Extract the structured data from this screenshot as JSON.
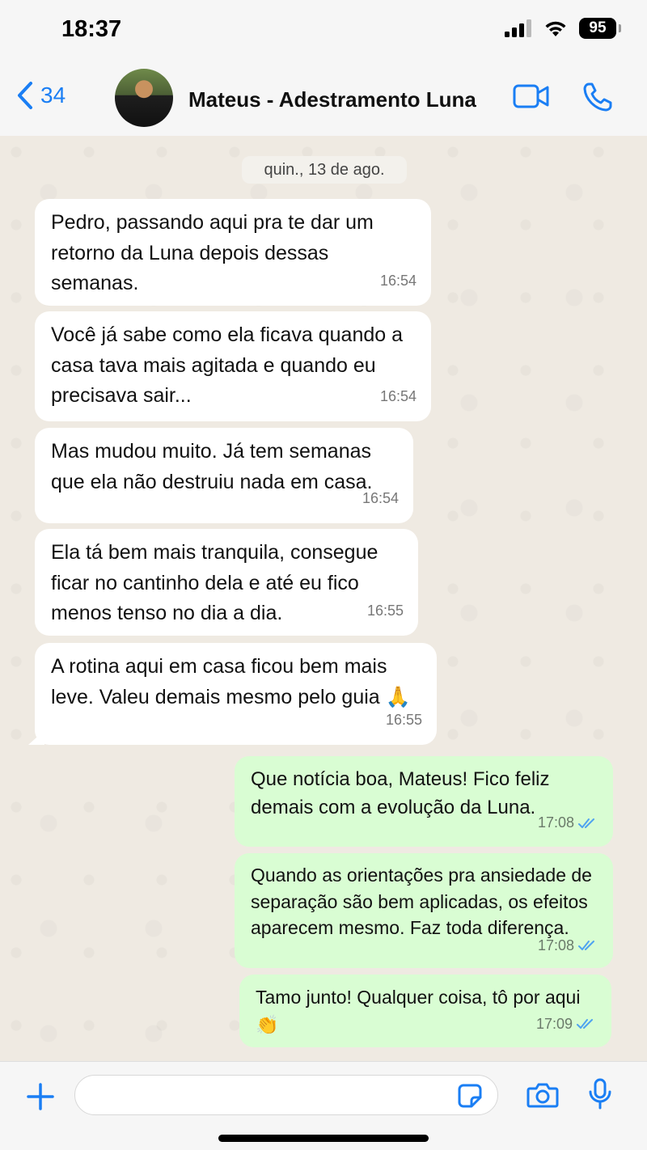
{
  "status_bar": {
    "time": "18:37",
    "battery": "95"
  },
  "header": {
    "back_count": "34",
    "contact_name": "Mateus - Adestramento Luna"
  },
  "chat": {
    "date": "quin., 13 de ago.",
    "incoming": [
      {
        "text": "Pedro, passando aqui pra te dar um retorno da Luna depois dessas semanas.",
        "time": "16:54"
      },
      {
        "text": "Você já sabe como ela ficava quando a casa tava mais agitada e quando eu precisava sair...",
        "time": "16:54"
      },
      {
        "text": "Mas mudou muito. Já tem semanas que ela não destruiu nada em casa.",
        "time": "16:54"
      },
      {
        "text": "Ela tá bem mais tranquila, consegue ficar no cantinho dela e até eu fico menos tenso no dia a dia.",
        "time": "16:55"
      },
      {
        "text": "A rotina aqui em casa ficou bem mais leve. Valeu demais mesmo pelo guia 🙏",
        "time": "16:55"
      }
    ],
    "outgoing": [
      {
        "text": "Que notícia boa, Mateus! Fico feliz demais com a evolução da Luna.",
        "time": "17:08",
        "status": "read"
      },
      {
        "text": "Quando as orientações pra ansiedade de separação são bem aplicadas, os efeitos aparecem mesmo. Faz toda diferença.",
        "time": "17:08",
        "status": "read"
      },
      {
        "text": "Tamo junto! Qualquer coisa, tô por aqui 👏",
        "time": "17:09",
        "status": "read"
      }
    ]
  },
  "input": {
    "placeholder": ""
  },
  "colors": {
    "accent": "#1a7ef4",
    "incoming_bubble": "#ffffff",
    "outgoing_bubble": "#d9fdd3",
    "read_ticks": "#4fa3f0"
  },
  "icons": [
    "signal-icon",
    "wifi-icon",
    "battery-icon",
    "back-chevron-icon",
    "video-call-icon",
    "phone-icon",
    "plus-icon",
    "sticker-icon",
    "camera-icon",
    "microphone-icon",
    "double-check-icon"
  ]
}
